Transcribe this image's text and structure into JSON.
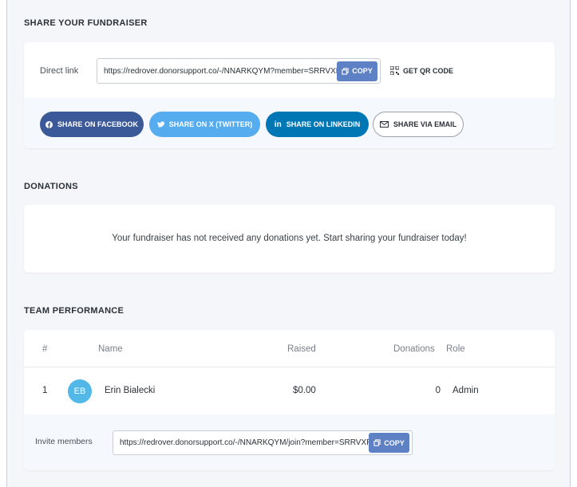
{
  "share": {
    "title": "SHARE YOUR FUNDRAISER",
    "direct_link_label": "Direct link",
    "direct_link_url": "https://redrover.donorsupport.co/-/NNARKQYM?member=SRRVXRDG",
    "copy_label": "COPY",
    "qr_label": "GET QR CODE",
    "buttons": {
      "facebook": "SHARE ON FACEBOOK",
      "twitter": "SHARE ON X (TWITTER)",
      "linkedin": "SHARE ON LINKEDIN",
      "email": "SHARE VIA EMAIL"
    }
  },
  "donations": {
    "title": "DONATIONS",
    "empty_message": "Your fundraiser has not received any donations yet. Start sharing your fundraiser today!"
  },
  "team": {
    "title": "TEAM PERFORMANCE",
    "headers": {
      "rank": "#",
      "name": "Name",
      "raised": "Raised",
      "donations": "Donations",
      "role": "Role"
    },
    "rows": [
      {
        "rank": "1",
        "initials": "EB",
        "name": "Erin Bialecki",
        "raised": "$0.00",
        "donations": "0",
        "role": "Admin"
      }
    ],
    "invite_label": "Invite members",
    "invite_url": "https://redrover.donorsupport.co/-/NNARKQYM/join?member=SRRVXRDG",
    "copy_label": "COPY"
  },
  "colors": {
    "facebook": "#3b5998",
    "twitter": "#55acee",
    "linkedin": "#0077b5",
    "copy": "#5e80c4",
    "avatar": "#51b8e8"
  }
}
